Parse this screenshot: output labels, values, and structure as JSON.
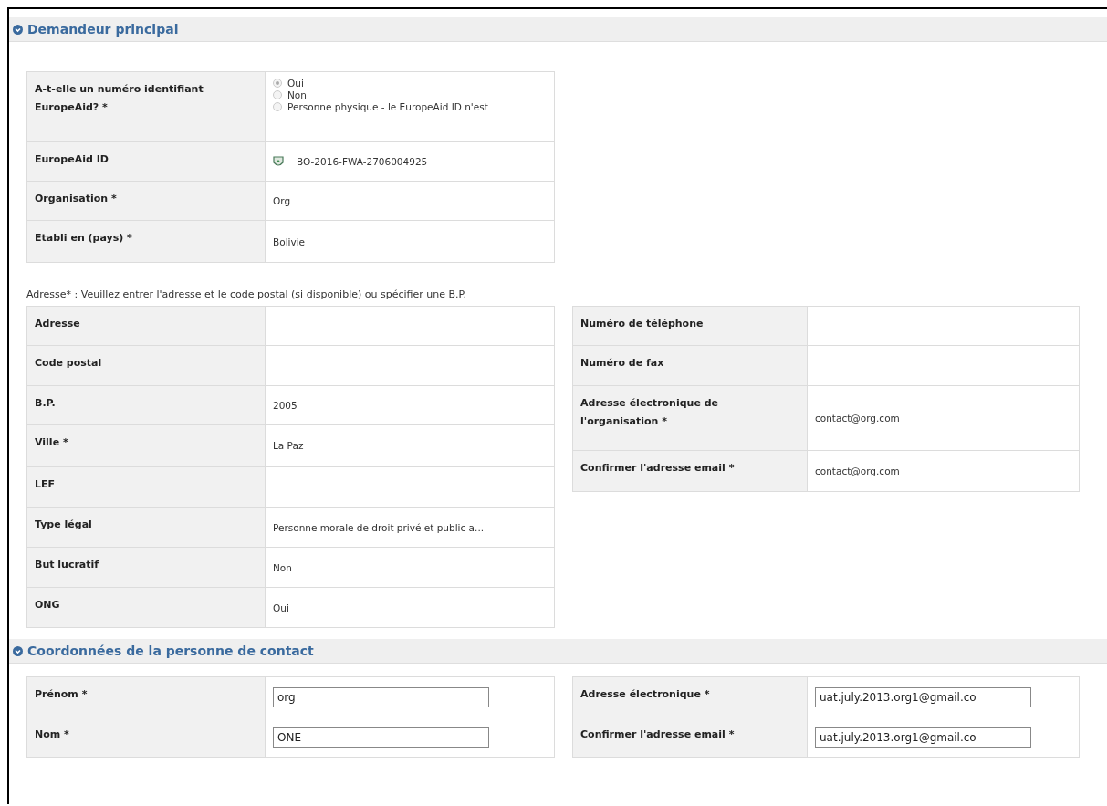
{
  "main_applicant": {
    "title": "Demandeur principal",
    "identification": [
      {
        "kind": "radio",
        "label": "A-t-elle un numéro identifiant EuropeAid? *",
        "options": [
          {
            "label": "Oui",
            "selected": true
          },
          {
            "label": "Non",
            "selected": false
          },
          {
            "label": "Personne physique - le EuropeAid ID n'est",
            "selected": false
          }
        ]
      },
      {
        "kind": "id",
        "label": "EuropeAid ID",
        "value": "BO-2016-FWA-2706004925"
      },
      {
        "kind": "text",
        "label": "Organisation *",
        "value": "Org"
      },
      {
        "kind": "text",
        "label": "Etabli en (pays) *",
        "value": "Bolivie"
      }
    ],
    "address_note": "Adresse* : Veuillez entrer l'adresse et le code postal (si disponible) ou spécifier une B.P.",
    "address": [
      {
        "kind": "text",
        "label": "Adresse"
      },
      {
        "kind": "text",
        "label": "Code postal"
      },
      {
        "kind": "text",
        "label": "B.P.",
        "value": "2005"
      },
      {
        "kind": "text",
        "label": "Ville *",
        "value": "La Paz"
      }
    ],
    "contact_numbers": [
      {
        "kind": "text",
        "label": "Numéro de téléphone"
      },
      {
        "kind": "text",
        "label": "Numéro de fax"
      },
      {
        "kind": "text",
        "label": "Adresse électronique de l'organisation *",
        "value": "contact@org.com"
      },
      {
        "kind": "text",
        "label": "Confirmer l'adresse email *",
        "value": "contact@org.com"
      }
    ],
    "legal": [
      {
        "kind": "text",
        "label": "LEF"
      },
      {
        "kind": "text",
        "label": "Type légal",
        "value": "Personne morale de droit privé et public a..."
      },
      {
        "kind": "text",
        "label": "But lucratif",
        "value": "Non"
      },
      {
        "kind": "text",
        "label": "ONG",
        "value": "Oui"
      }
    ]
  },
  "contact_person": {
    "title": "Coordonnées de la personne de contact",
    "names": [
      {
        "kind": "input",
        "label": "Prénom *",
        "value": "org"
      },
      {
        "kind": "input",
        "label": "Nom *",
        "value": "ONE"
      }
    ],
    "emails": [
      {
        "kind": "input",
        "label": "Adresse électronique *",
        "value": "uat.july.2013.org1@gmail.co"
      },
      {
        "kind": "input",
        "label": "Confirmer l'adresse email *",
        "value": "uat.july.2013.org1@gmail.co"
      }
    ]
  }
}
